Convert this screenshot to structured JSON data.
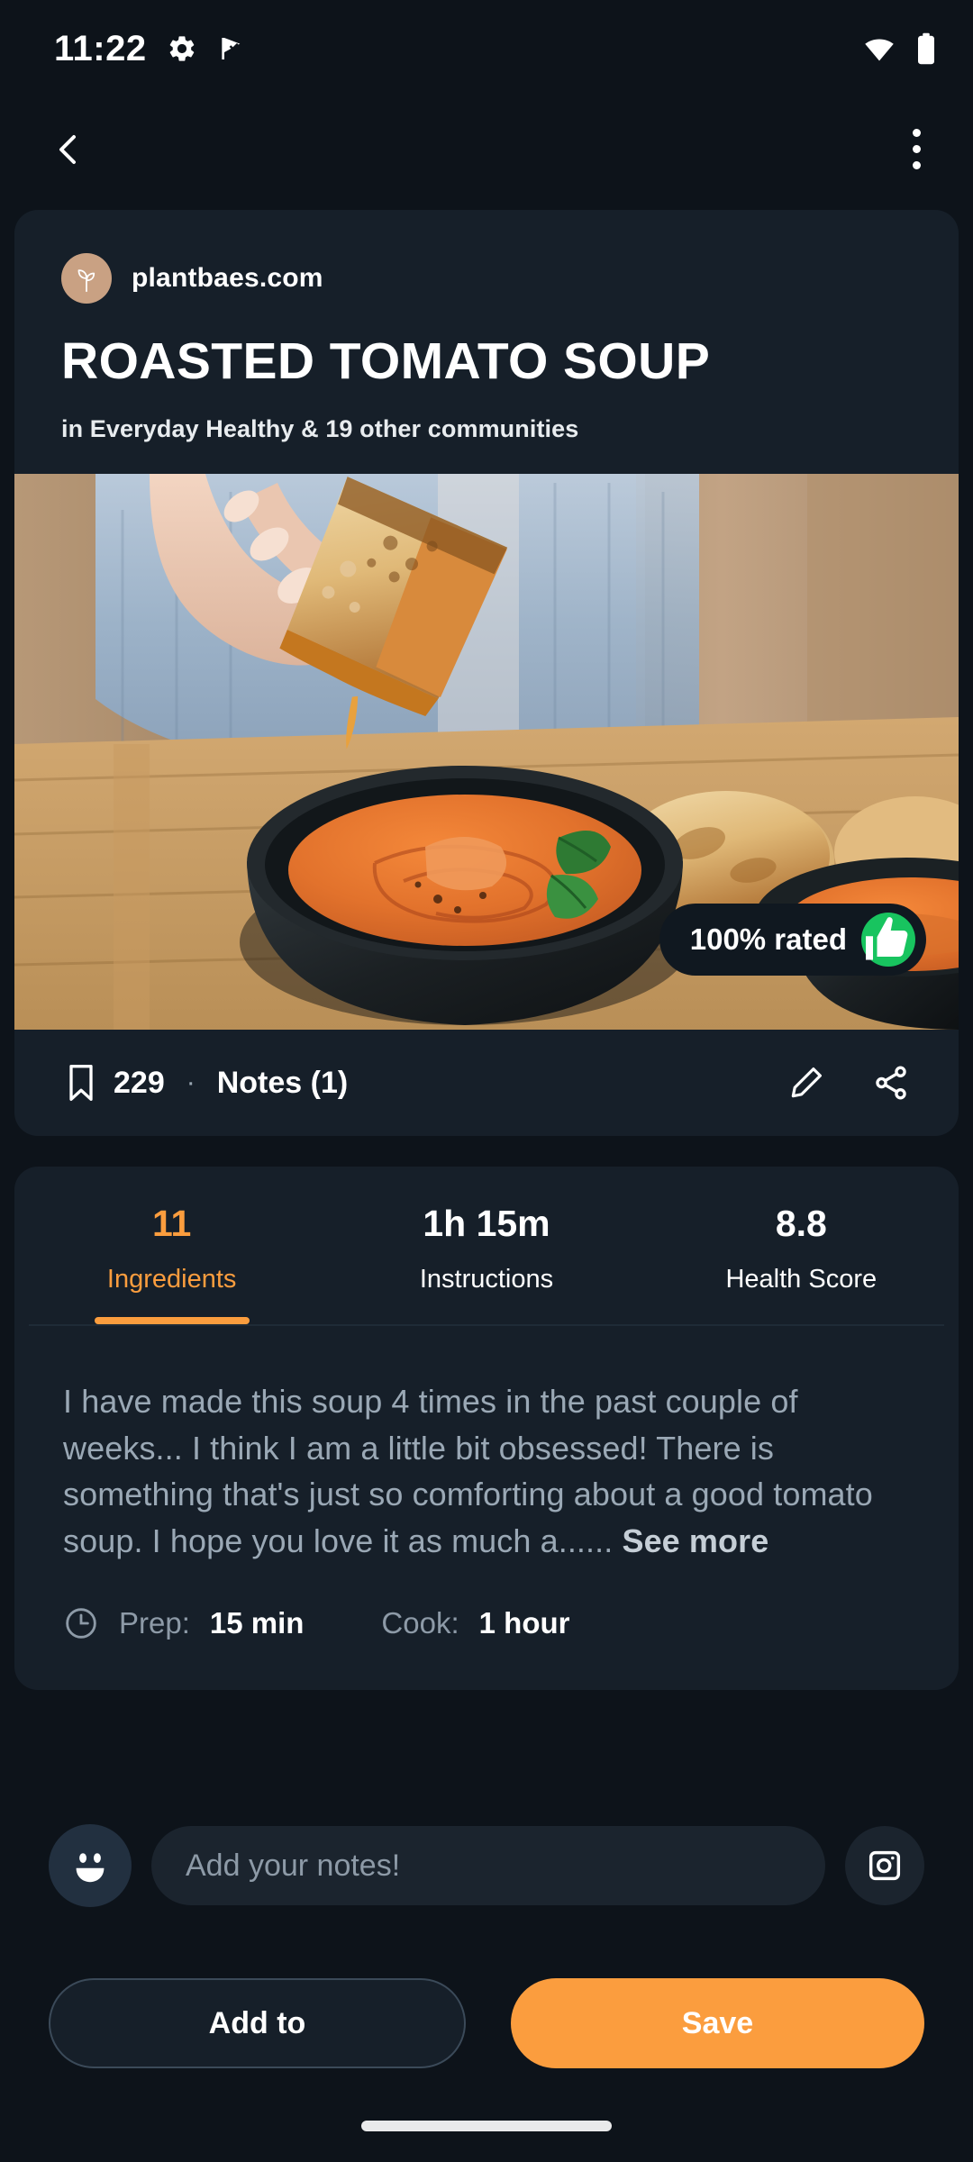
{
  "status_bar": {
    "time": "11:22",
    "left_icons": [
      "gear-icon",
      "flag-check-icon"
    ],
    "right_icons": [
      "wifi-icon",
      "battery-icon"
    ]
  },
  "top_bar": {
    "back_icon": "chevron-left-icon",
    "overflow_icon": "more-vertical-icon"
  },
  "recipe": {
    "brand": "plantbaes.com",
    "brand_avatar_icon": "plant-sprout-icon",
    "brand_avatar_color": "#c9a183",
    "title": "ROASTED TOMATO SOUP",
    "communities": "in Everyday Healthy & 19 other communities",
    "rating_badge": {
      "text": "100% rated",
      "icon": "thumbs-up-icon",
      "icon_bg": "#18c45f"
    }
  },
  "action_bar": {
    "bookmark_icon": "bookmark-icon",
    "bookmark_count": "229",
    "separator": "·",
    "notes_label": "Notes (1)",
    "edit_icon": "pencil-icon",
    "share_icon": "share-icon"
  },
  "tabs": [
    {
      "value": "11",
      "label": "Ingredients",
      "active": true
    },
    {
      "value": "1h 15m",
      "label": "Instructions",
      "active": false
    },
    {
      "value": "8.8",
      "label": "Health Score",
      "active": false
    }
  ],
  "description": {
    "text": "I have made this soup 4 times in the past couple of weeks... I think I am a little bit obsessed! There is something that's just so comforting about a good tomato soup. I hope you love it as much a......",
    "see_more": "See more"
  },
  "times": {
    "clock_icon": "clock-icon",
    "prep_label": "Prep:",
    "prep_value": "15 min",
    "cook_label": "Cook:",
    "cook_value": "1 hour"
  },
  "note_input": {
    "avatar_icon": "smiley-face-icon",
    "placeholder": "Add your notes!",
    "camera_icon": "camera-icon"
  },
  "buttons": {
    "add_to": "Add to",
    "save": "Save",
    "save_color": "#fb9d3e"
  }
}
